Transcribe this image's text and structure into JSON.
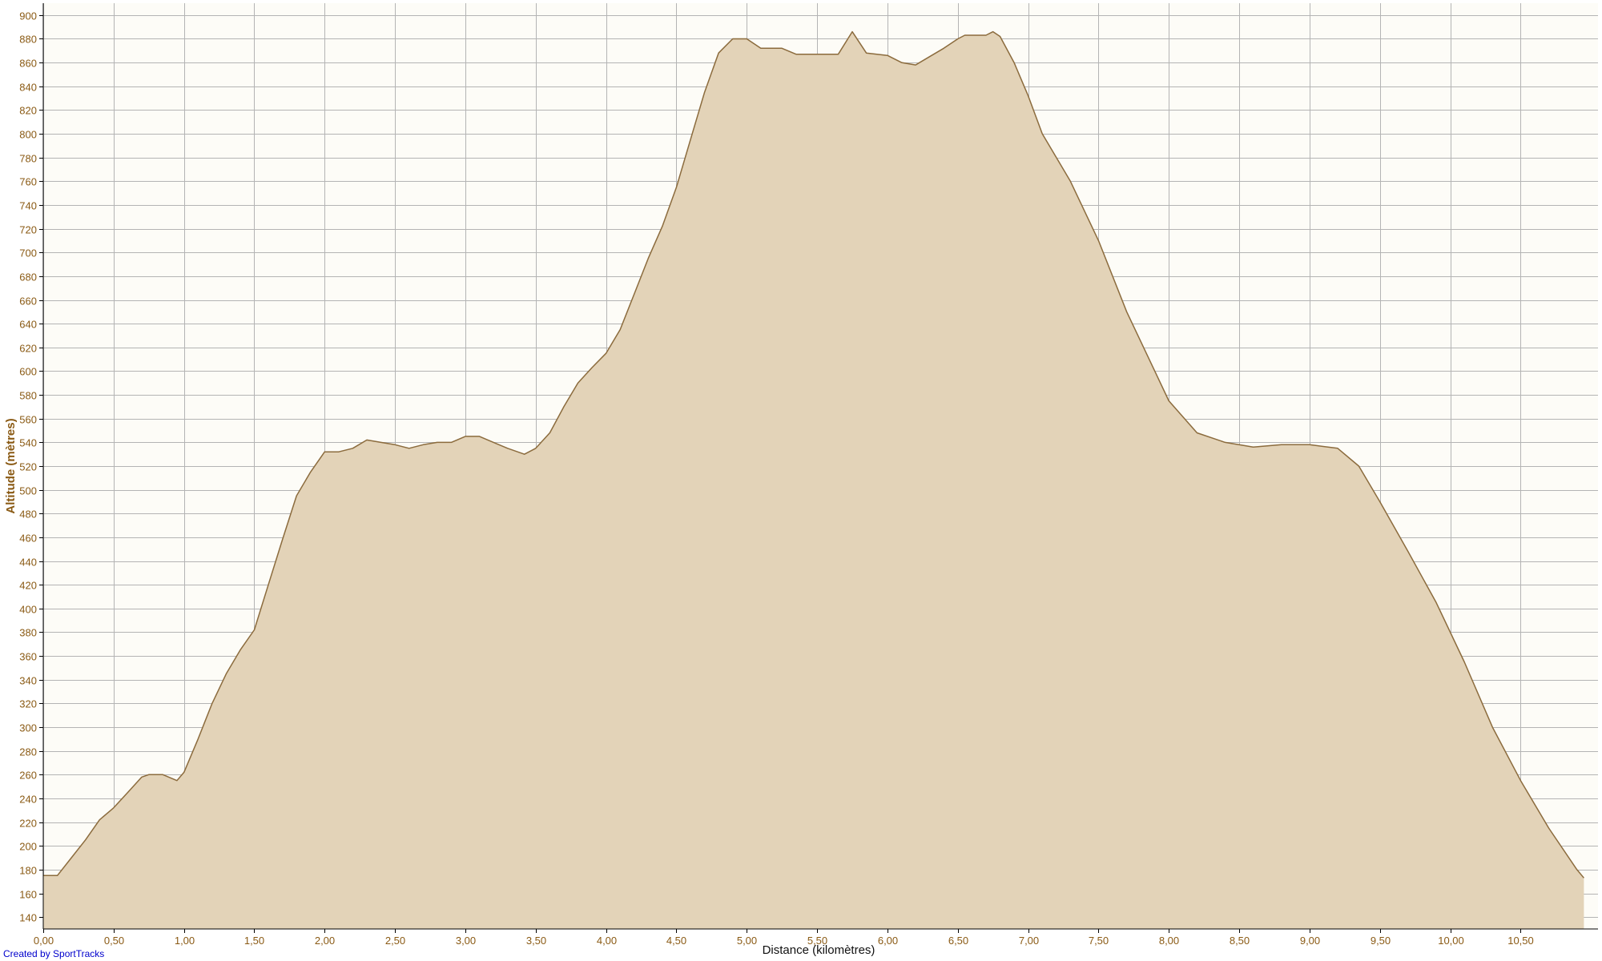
{
  "credit_text": "Created by SportTracks",
  "colors": {
    "plot_background": "#fdfcf7",
    "grid": "#b4b4b4",
    "area_fill": "#e3d3b8",
    "area_stroke": "#8b6b3d",
    "tick_text": "#8a5a14",
    "axis": "#000000"
  },
  "chart_data": {
    "type": "area",
    "title": "",
    "xlabel": "Distance (kilomètres)",
    "ylabel": "Altitude (mètres)",
    "xlim": [
      0,
      11.05
    ],
    "ylim": [
      130,
      910
    ],
    "x_ticks": [
      0,
      0.5,
      1,
      1.5,
      2,
      2.5,
      3,
      3.5,
      4,
      4.5,
      5,
      5.5,
      6,
      6.5,
      7,
      7.5,
      8,
      8.5,
      9,
      9.5,
      10,
      10.5
    ],
    "x_tick_labels": [
      "0,00",
      "0,50",
      "1,00",
      "1,50",
      "2,00",
      "2,50",
      "3,00",
      "3,50",
      "4,00",
      "4,50",
      "5,00",
      "5,50",
      "6,00",
      "6,50",
      "7,00",
      "7,50",
      "8,00",
      "8,50",
      "9,00",
      "9,50",
      "10,00",
      "10,50"
    ],
    "y_ticks": [
      140,
      160,
      180,
      200,
      220,
      240,
      260,
      280,
      300,
      320,
      340,
      360,
      380,
      400,
      420,
      440,
      460,
      480,
      500,
      520,
      540,
      560,
      580,
      600,
      620,
      640,
      660,
      680,
      700,
      720,
      740,
      760,
      780,
      800,
      820,
      840,
      860,
      880,
      900
    ],
    "grid": true,
    "legend": "none",
    "series": [
      {
        "x": [
          0,
          0.1,
          0.2,
          0.3,
          0.4,
          0.5,
          0.6,
          0.7,
          0.75,
          0.85,
          0.95,
          1.0,
          1.1,
          1.2,
          1.3,
          1.4,
          1.5,
          1.6,
          1.7,
          1.8,
          1.9,
          2.0,
          2.1,
          2.2,
          2.3,
          2.4,
          2.5,
          2.6,
          2.7,
          2.8,
          2.9,
          3.0,
          3.1,
          3.2,
          3.3,
          3.42,
          3.5,
          3.6,
          3.7,
          3.8,
          3.9,
          4.0,
          4.1,
          4.2,
          4.3,
          4.4,
          4.5,
          4.6,
          4.7,
          4.8,
          4.9,
          5.0,
          5.1,
          5.15,
          5.25,
          5.35,
          5.5,
          5.65,
          5.75,
          5.85,
          6.0,
          6.1,
          6.2,
          6.3,
          6.4,
          6.5,
          6.55,
          6.6,
          6.7,
          6.75,
          6.8,
          6.9,
          7.0,
          7.1,
          7.3,
          7.5,
          7.7,
          7.9,
          8.0,
          8.2,
          8.4,
          8.6,
          8.8,
          9.0,
          9.2,
          9.35,
          9.5,
          9.7,
          9.9,
          10.1,
          10.3,
          10.5,
          10.7,
          10.9,
          10.95
        ],
        "y": [
          175,
          175,
          190,
          205,
          222,
          232,
          245,
          258,
          260,
          260,
          255,
          262,
          290,
          320,
          345,
          365,
          382,
          420,
          458,
          495,
          515,
          532,
          532,
          535,
          542,
          540,
          538,
          535,
          538,
          540,
          540,
          545,
          545,
          540,
          535,
          530,
          535,
          548,
          570,
          590,
          603,
          615,
          635,
          665,
          695,
          722,
          755,
          795,
          835,
          868,
          880,
          880,
          872,
          872,
          872,
          867,
          867,
          867,
          886,
          868,
          866,
          860,
          858,
          865,
          872,
          880,
          883,
          883,
          883,
          886,
          882,
          860,
          832,
          800,
          760,
          710,
          650,
          600,
          575,
          548,
          540,
          536,
          538,
          538,
          535,
          520,
          490,
          448,
          405,
          355,
          300,
          255,
          215,
          180,
          173
        ]
      }
    ]
  }
}
